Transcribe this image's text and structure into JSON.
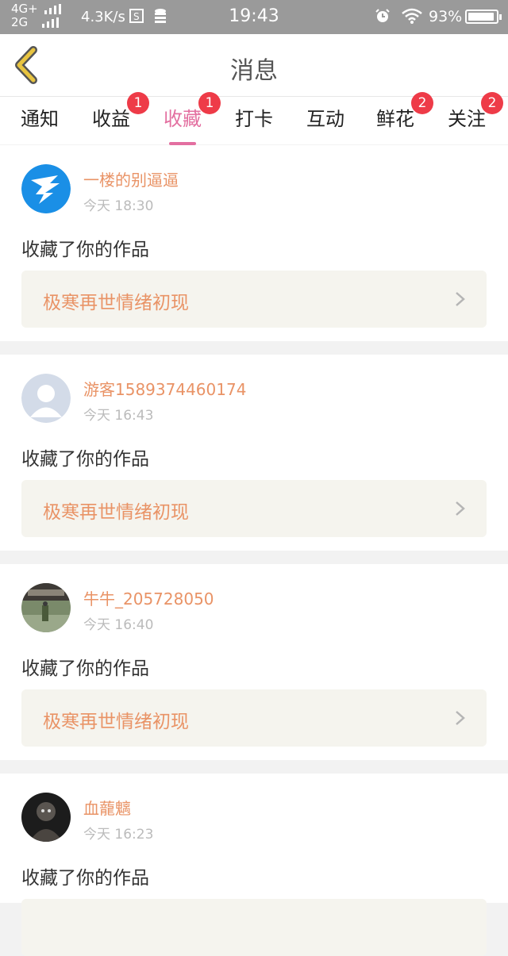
{
  "status_bar": {
    "network_top": "4G+",
    "network_bottom": "2G",
    "speed": "4.3K/s",
    "time": "19:43",
    "battery_percent": "93%",
    "battery_level": 0.93,
    "icons": [
      "sim-icon",
      "database-icon",
      "alarm-icon",
      "wifi-icon",
      "battery-icon"
    ]
  },
  "header": {
    "title": "消息",
    "back_icon": "chevron-left-icon",
    "accent_color": "#e8c440"
  },
  "tabs": [
    {
      "label": "通知",
      "badge": ""
    },
    {
      "label": "收益",
      "badge": "1"
    },
    {
      "label": "收藏",
      "badge": "1",
      "active": true
    },
    {
      "label": "打卡",
      "badge": ""
    },
    {
      "label": "互动",
      "badge": ""
    },
    {
      "label": "鲜花",
      "badge": "2"
    },
    {
      "label": "关注",
      "badge": "2"
    }
  ],
  "colors": {
    "active_tab": "#e36fa0",
    "badge": "#ee3b48",
    "username": "#e99366",
    "work_box_bg": "#f5f4ee"
  },
  "messages": [
    {
      "username": "一楼的别逼逼",
      "time": "今天 18:30",
      "action": "收藏了你的作品",
      "work_title": "极寒再世情绪初现",
      "avatar": "bird-logo-avatar"
    },
    {
      "username": "游客1589374460174",
      "time": "今天 16:43",
      "action": "收藏了你的作品",
      "work_title": "极寒再世情绪初现",
      "avatar": "default-user-avatar"
    },
    {
      "username": "牛牛_205728050",
      "time": "今天 16:40",
      "action": "收藏了你的作品",
      "work_title": "极寒再世情绪初现",
      "avatar": "photo-avatar"
    },
    {
      "username": "血蘢魑",
      "time": "今天 16:23",
      "action": "收藏了你的作品",
      "work_title": "",
      "avatar": "dark-photo-avatar"
    }
  ]
}
